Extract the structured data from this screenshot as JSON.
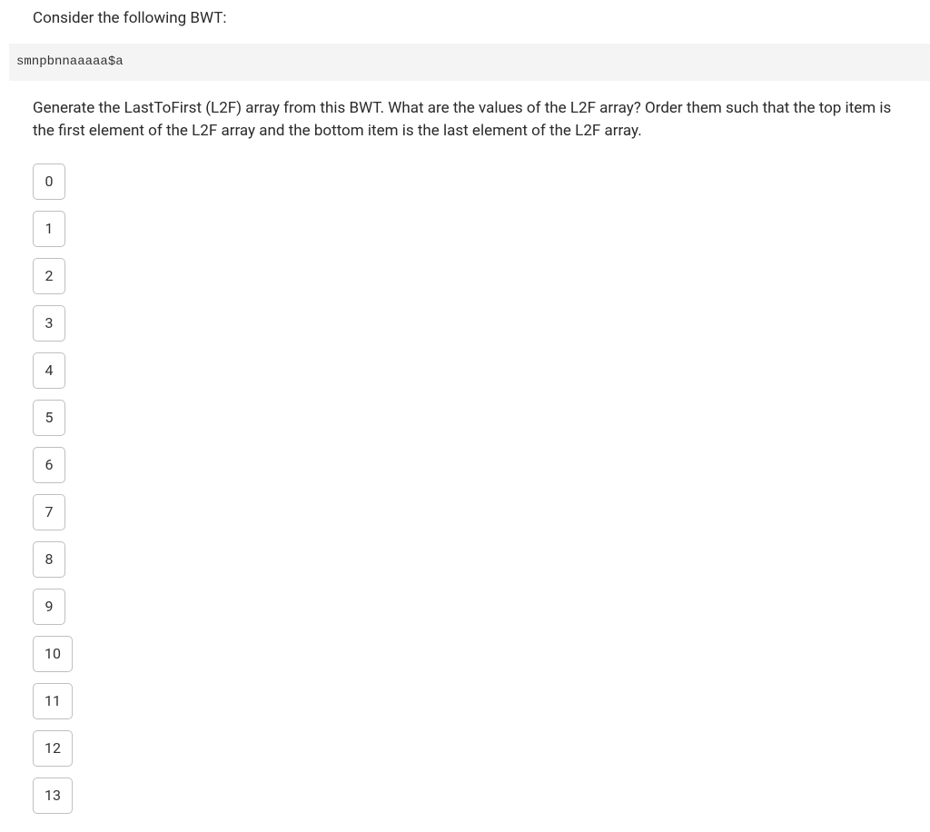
{
  "intro": "Consider the following BWT:",
  "code": "smnpbnnaaaaa$a",
  "instruction": "Generate the LastToFirst (L2F) array from this BWT. What are the values of the L2F array? Order them such that the top item is the first element of the L2F array and the bottom item is the last element of the L2F array.",
  "items": [
    "0",
    "1",
    "2",
    "3",
    "4",
    "5",
    "6",
    "7",
    "8",
    "9",
    "10",
    "11",
    "12",
    "13"
  ]
}
